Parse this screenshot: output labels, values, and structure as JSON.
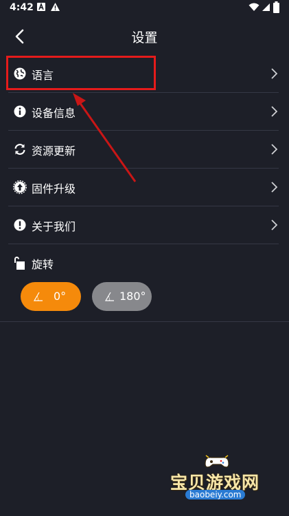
{
  "status_bar": {
    "time": "4:42"
  },
  "header": {
    "title": "设置"
  },
  "menu": {
    "items": [
      {
        "label": "语言",
        "icon": "globe-icon"
      },
      {
        "label": "设备信息",
        "icon": "info-icon"
      },
      {
        "label": "资源更新",
        "icon": "refresh-icon"
      },
      {
        "label": "固件升级",
        "icon": "firmware-upgrade-icon"
      },
      {
        "label": "关于我们",
        "icon": "exclamation-icon"
      }
    ],
    "rotation": {
      "label": "旋转",
      "icon": "rotate-icon",
      "options": [
        {
          "label": "0°",
          "selected": true
        },
        {
          "label": "180°",
          "selected": false
        }
      ]
    }
  },
  "colors": {
    "background": "#1d1f28",
    "accent": "#f58a0b",
    "inactive_button": "#87888c",
    "annotation": "#e51b1b",
    "divider": "#353845"
  },
  "watermark": {
    "title": "宝贝游戏网",
    "url": "baobeiy.com"
  }
}
